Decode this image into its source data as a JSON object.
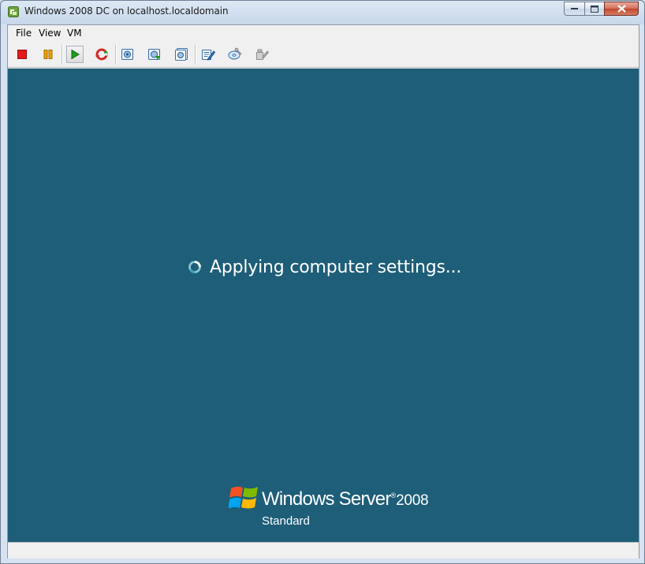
{
  "window": {
    "title": "Windows 2008 DC on localhost.localdomain"
  },
  "menu": [
    {
      "label": "File"
    },
    {
      "label": "View"
    },
    {
      "label": "VM"
    }
  ],
  "toolbar": {
    "buttons": [
      {
        "icon": "stop-icon",
        "color": "#e11a1a"
      },
      {
        "icon": "pause-icon",
        "color": "#f0a000"
      },
      {
        "icon": "play-icon",
        "color": "#1ca01c",
        "pressed": true
      },
      {
        "icon": "reset-icon",
        "color": "#d42a2a"
      },
      {
        "icon": "snapshot-take-icon"
      },
      {
        "icon": "snapshot-revert-icon"
      },
      {
        "icon": "snapshot-manager-icon"
      },
      {
        "icon": "edit-settings-icon"
      },
      {
        "icon": "cd-connect-icon"
      },
      {
        "icon": "device-disabled-icon"
      }
    ]
  },
  "console": {
    "background": "#1e5e78",
    "status_text": "Applying computer settings...",
    "brand": {
      "name": "Windows Server",
      "trademark": "®",
      "year": "2008",
      "edition": "Standard"
    }
  }
}
